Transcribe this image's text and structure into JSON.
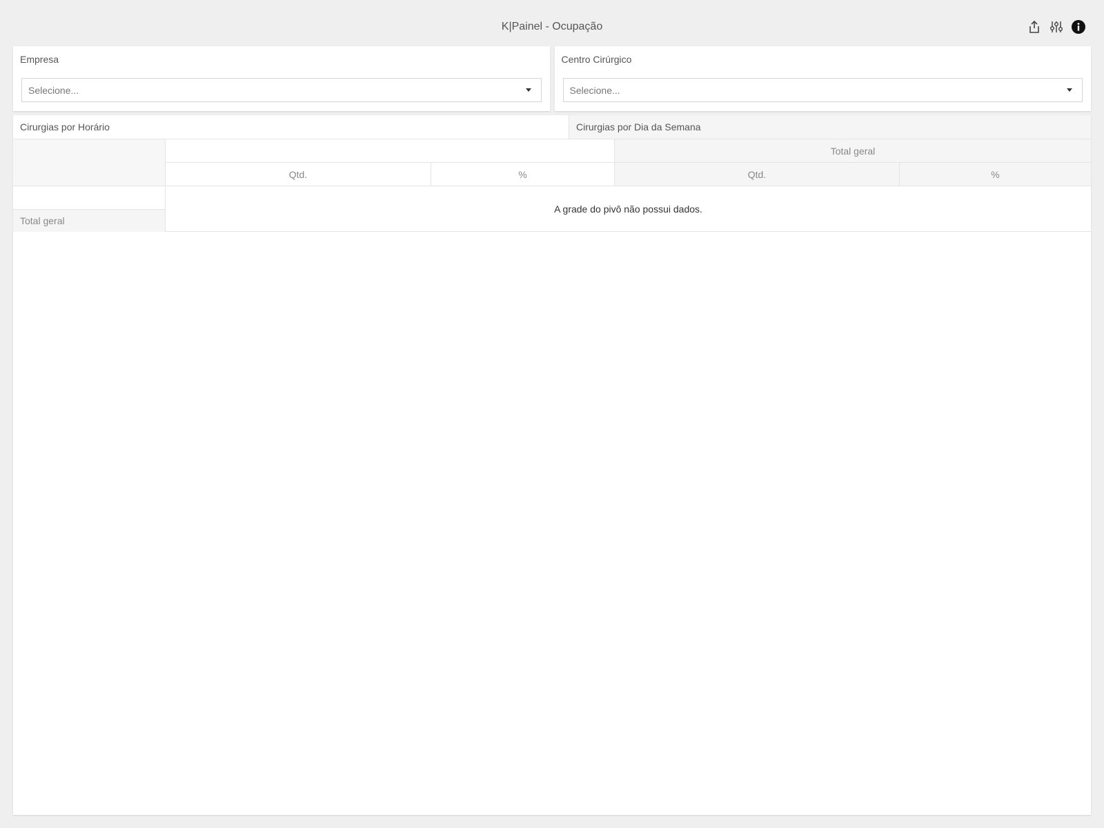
{
  "header": {
    "title": "K|Painel - Ocupação",
    "actions": [
      {
        "name": "share-icon"
      },
      {
        "name": "filter-settings-icon"
      },
      {
        "name": "info-icon"
      }
    ]
  },
  "filters": [
    {
      "label": "Empresa",
      "placeholder": "Selecione..."
    },
    {
      "label": "Centro Cirúrgico",
      "placeholder": "Selecione..."
    }
  ],
  "tabs": [
    {
      "label": "Cirurgias por Horário",
      "active": true
    },
    {
      "label": "Cirurgias por Dia da Semana",
      "active": false
    }
  ],
  "pivot": {
    "grand_total_header": "Total geral",
    "measure_qtd": "Qtd.",
    "measure_pct": "%",
    "row_grand_total": "Total geral",
    "no_data_message": "A grade do pivô não possui dados."
  },
  "colors": {
    "background": "#efefef",
    "panel": "#ffffff",
    "header_cell": "#f5f5f5",
    "border": "#e4e4e4"
  }
}
